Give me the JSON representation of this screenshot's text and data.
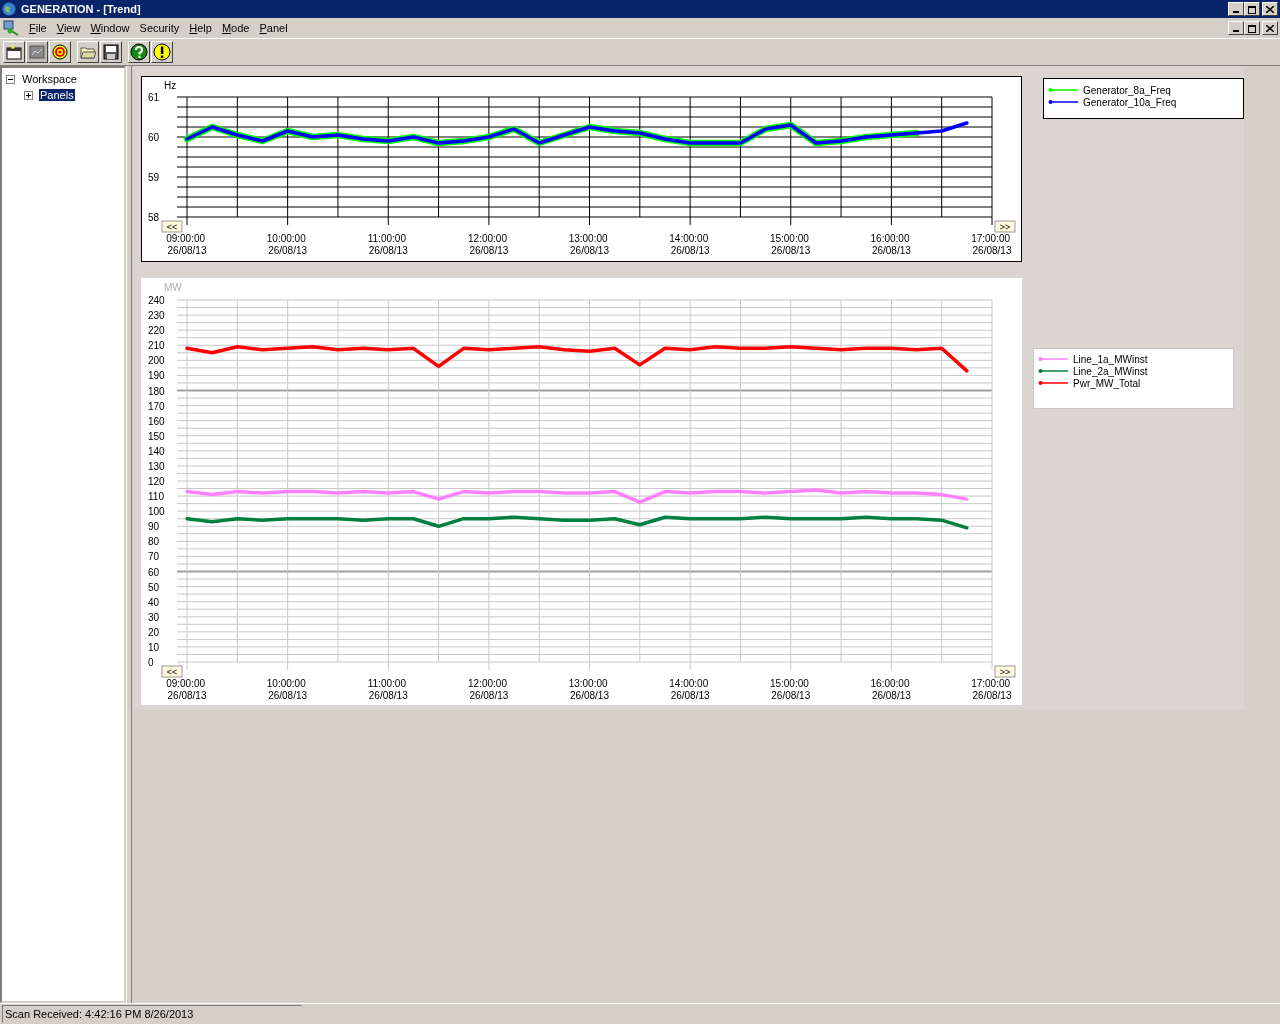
{
  "app": {
    "title": "GENERATION - [Trend]"
  },
  "menu": [
    {
      "label": "File",
      "mnemonic": true
    },
    {
      "label": "View",
      "mnemonic": true
    },
    {
      "label": "Window",
      "mnemonic": true
    },
    {
      "label": "Security",
      "mnemonic": false
    },
    {
      "label": "Help",
      "mnemonic": true
    },
    {
      "label": "Mode",
      "mnemonic": true
    },
    {
      "label": "Panel",
      "mnemonic": true
    }
  ],
  "toolbar": [
    {
      "kind": "new",
      "disabled": false
    },
    {
      "kind": "chart",
      "disabled": true
    },
    {
      "kind": "target",
      "disabled": false
    },
    {
      "kind": "open",
      "disabled": false
    },
    {
      "kind": "save",
      "disabled": false
    },
    {
      "kind": "help",
      "disabled": false
    },
    {
      "kind": "alert",
      "disabled": false
    }
  ],
  "tree": [
    {
      "label": "Workspace",
      "expanded": true,
      "selected": false,
      "children": [
        {
          "label": "Panels",
          "expanded": false,
          "selected": true
        }
      ]
    }
  ],
  "panels": [
    {
      "dimmed": false,
      "nav_left": "<<",
      "nav_right": ">>",
      "chart_data": {
        "type": "line",
        "grid": true,
        "legend": true,
        "ylabel": "Hz",
        "ylim": [
          58,
          61
        ],
        "yticks": [
          58,
          59,
          60,
          61
        ],
        "categories": [
          "09:00:00 26/08/13",
          null,
          null,
          null,
          "10:00:00 26/08/13",
          null,
          null,
          null,
          "11:00:00 26/08/13",
          null,
          null,
          null,
          "12:00:00 26/08/13",
          null,
          null,
          null,
          "13:00:00 26/08/13",
          null,
          null,
          null,
          "14:00:00 26/08/13",
          null,
          null,
          null,
          "15:00:00 26/08/13",
          null,
          null,
          null,
          "16:00:00 26/08/13",
          null,
          null,
          null,
          "17:00:00 26/08/13"
        ],
        "series": [
          {
            "name": "Generator_8a_Freq",
            "color": "#00ff00",
            "values": [
              59.95,
              60.25,
              60.05,
              59.9,
              60.15,
              60.0,
              60.05,
              59.95,
              59.9,
              60.0,
              59.85,
              59.9,
              60.0,
              60.2,
              59.85,
              60.05,
              60.25,
              60.15,
              60.1,
              59.95,
              59.85,
              59.85,
              59.85,
              60.2,
              60.3,
              59.85,
              59.9,
              60.0,
              60.05,
              60.1,
              null,
              null,
              null
            ]
          },
          {
            "name": "Generator_10a_Freq",
            "color": "#0000ff",
            "values": [
              59.95,
              60.25,
              60.05,
              59.9,
              60.15,
              60.0,
              60.05,
              59.95,
              59.9,
              60.0,
              59.85,
              59.9,
              60.0,
              60.2,
              59.85,
              60.05,
              60.25,
              60.15,
              60.1,
              59.95,
              59.85,
              59.85,
              59.85,
              60.2,
              60.3,
              59.85,
              59.9,
              60.0,
              60.05,
              60.1,
              60.15,
              60.35,
              null
            ]
          }
        ]
      }
    },
    {
      "dimmed": true,
      "nav_left": "<<",
      "nav_right": ">>",
      "chart_data": {
        "type": "line",
        "grid": true,
        "legend": true,
        "ylabel": "MW",
        "ylim": [
          0,
          240
        ],
        "yticks": [
          0,
          10,
          20,
          30,
          40,
          50,
          60,
          70,
          80,
          90,
          100,
          110,
          120,
          130,
          140,
          150,
          160,
          170,
          180,
          190,
          200,
          210,
          220,
          230,
          240
        ],
        "categories": [
          "09:00:00 26/08/13",
          null,
          null,
          null,
          "10:00:00 26/08/13",
          null,
          null,
          null,
          "11:00:00 26/08/13",
          null,
          null,
          null,
          "12:00:00 26/08/13",
          null,
          null,
          null,
          "13:00:00 26/08/13",
          null,
          null,
          null,
          "14:00:00 26/08/13",
          null,
          null,
          null,
          "15:00:00 26/08/13",
          null,
          null,
          null,
          "16:00:00 26/08/13",
          null,
          null,
          null,
          "17:00:00 26/08/13"
        ],
        "series": [
          {
            "name": "Line_1a_MWinst",
            "color": "#ff80ff",
            "values": [
              113,
              111,
              113,
              112,
              113,
              113,
              112,
              113,
              112,
              113,
              108,
              113,
              112,
              113,
              113,
              112,
              112,
              113,
              106,
              113,
              112,
              113,
              113,
              112,
              113,
              114,
              112,
              113,
              112,
              112,
              111,
              108,
              null
            ]
          },
          {
            "name": "Line_2a_MWinst",
            "color": "#008040",
            "values": [
              95,
              93,
              95,
              94,
              95,
              95,
              95,
              94,
              95,
              95,
              90,
              95,
              95,
              96,
              95,
              94,
              94,
              95,
              91,
              96,
              95,
              95,
              95,
              96,
              95,
              95,
              95,
              96,
              95,
              95,
              94,
              89,
              null
            ]
          },
          {
            "name": "Pwr_MW_Total",
            "color": "#ff0000",
            "values": [
              208,
              205,
              209,
              207,
              208,
              209,
              207,
              208,
              207,
              208,
              196,
              208,
              207,
              208,
              209,
              207,
              206,
              208,
              197,
              208,
              207,
              209,
              208,
              208,
              209,
              208,
              207,
              208,
              208,
              207,
              208,
              193,
              null
            ]
          }
        ]
      }
    }
  ],
  "status_bar": {
    "text": "Scan Received: 4:42:16 PM 8/26/2013"
  }
}
